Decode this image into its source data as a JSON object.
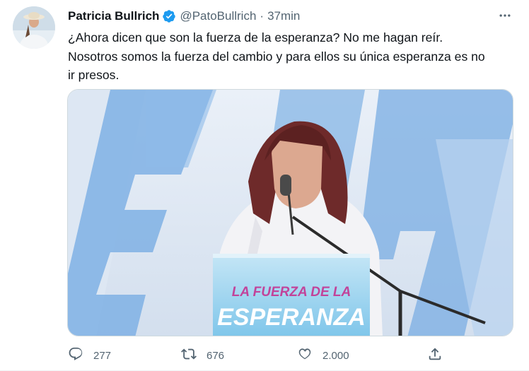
{
  "author": {
    "display_name": "Patricia Bullrich",
    "handle": "@PatoBullrich",
    "separator": "·",
    "timestamp": "37min",
    "verified": true
  },
  "tweet": {
    "text_lines": [
      "¿Ahora dicen que son la fuerza de la esperanza? No me hagan reír.",
      "Nosotros somos la fuerza del cambio y para ellos su única esperanza es no",
      "ir presos."
    ]
  },
  "media": {
    "podium_line1": "LA FUERZA DE LA",
    "podium_line2": "ESPERANZA"
  },
  "actions": {
    "reply_count": "277",
    "retweet_count": "676",
    "like_count": "2.000"
  },
  "icons": {
    "verified": "verified-badge-icon",
    "more": "more-icon",
    "reply": "reply-icon",
    "retweet": "retweet-icon",
    "like": "like-icon",
    "share": "share-icon"
  },
  "colors": {
    "verified": "#1d9bf0",
    "secondary_text": "#536471",
    "primary_text": "#0f1419",
    "podium_text": "#c2439a",
    "podium_text_2": "#ffffff"
  }
}
